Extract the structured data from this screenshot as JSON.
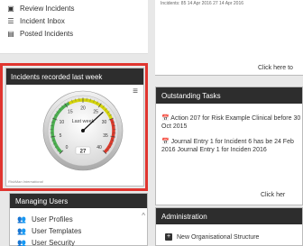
{
  "left_menu": {
    "items": [
      {
        "icon": "review-icon",
        "label": "Review Incidents"
      },
      {
        "icon": "list-icon",
        "label": "Incident Inbox"
      },
      {
        "icon": "posted-icon",
        "label": "Posted Incidents"
      }
    ]
  },
  "gauge_widget": {
    "title": "Incidents recorded last week",
    "gauge_label": "Last week",
    "value": 27,
    "ticks": [
      "0",
      "5",
      "10",
      "15",
      "20",
      "25",
      "30",
      "35",
      "40"
    ],
    "max": 40,
    "credit": "RiskMan International"
  },
  "managing_users": {
    "title": "Managing Users",
    "items": [
      {
        "icon": "users-icon",
        "label": "User Profiles"
      },
      {
        "icon": "users-icon",
        "label": "User Templates"
      },
      {
        "icon": "users-icon",
        "label": "User Security"
      }
    ]
  },
  "incidents_panel": {
    "row_text": "Incidents: 85    14 Apr 2016  27  14 Apr 2016",
    "click_here": "Click here to"
  },
  "tasks": {
    "title": "Outstanding Tasks",
    "items": [
      {
        "text": "Action 207 for Risk Example Clinical before 30 Oct 2015"
      },
      {
        "text": "Journal Entry 1 for Incident 6 has be 24 Feb 2016 Journal Entry 1 for Inciden 2016"
      }
    ],
    "click_here": "Click her"
  },
  "administration": {
    "title": "Administration",
    "items": [
      {
        "icon": "plus-icon",
        "label": "New Organisational Structure"
      }
    ]
  },
  "colors": {
    "header": "#2d2d2d",
    "highlight": "#e0352f",
    "gauge_green": "#4caf50",
    "gauge_yellow": "#d4d40a",
    "gauge_red": "#d93a2b"
  }
}
